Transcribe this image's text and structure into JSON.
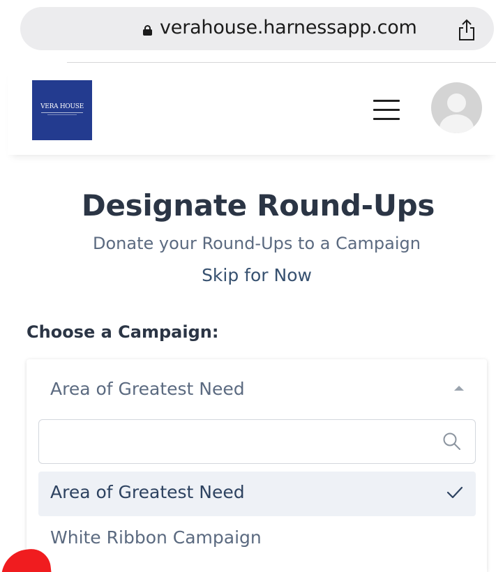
{
  "browser": {
    "url": "verahouse.harnessapp.com",
    "lock_icon": "lock-icon",
    "share_icon": "share-icon"
  },
  "header": {
    "logo_text": "VERA HOUSE",
    "menu_icon": "hamburger-menu-icon",
    "avatar_icon": "user-avatar-icon"
  },
  "main": {
    "title": "Designate Round-Ups",
    "subtitle": "Donate your Round-Ups to a Campaign",
    "skip_label": "Skip for Now",
    "field_label": "Choose a Campaign:"
  },
  "campaign_select": {
    "selected_value": "Area of Greatest Need",
    "search_placeholder": "",
    "search_value": "",
    "options": [
      {
        "label": "Area of Greatest Need",
        "selected": true
      },
      {
        "label": "White Ribbon Campaign",
        "selected": false
      }
    ]
  },
  "colors": {
    "logo_bg": "#233b8f",
    "title": "#2b3545",
    "muted": "#5b6a80",
    "link": "#36506f",
    "option_selected_bg": "#eef1f6",
    "red_marker": "#f01c1f"
  }
}
